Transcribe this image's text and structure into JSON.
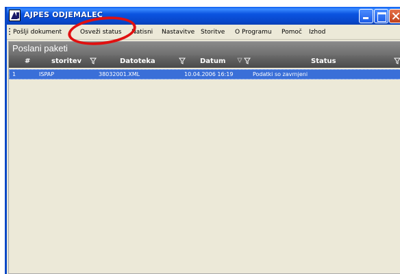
{
  "window": {
    "title": "AJPES ODJEMALEC"
  },
  "menu": {
    "items": [
      "Pošlji dokument",
      "Osveži status",
      "Natisni",
      "Nastavitve",
      "Storitve",
      "O Programu",
      "Pomoč",
      "Izhod"
    ]
  },
  "panel": {
    "title": "Poslani paketi"
  },
  "table": {
    "columns": [
      "#",
      "storitev",
      "Datoteka",
      "Datum",
      "Status"
    ],
    "rows": [
      {
        "num": "1",
        "service": "ISPAP",
        "file": "38032001.XML",
        "date": "10.04.2006 16:19",
        "status": "Podatki so zavrnjeni"
      }
    ]
  },
  "colors": {
    "titlebar": "#0b54e0",
    "selected_row": "#3a6fd8",
    "annotation": "#e01010"
  }
}
